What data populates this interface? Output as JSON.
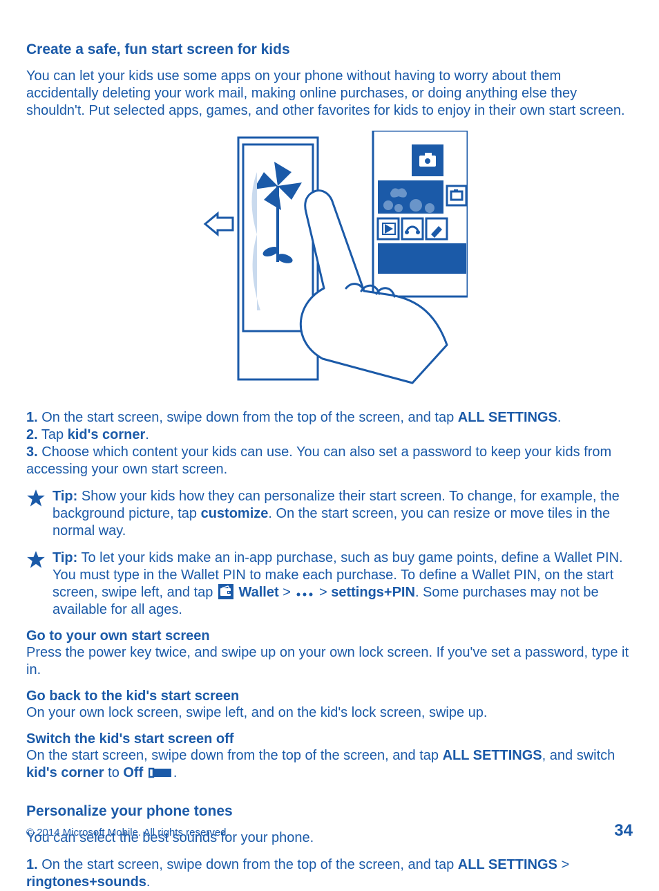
{
  "section1": {
    "title": "Create a safe, fun start screen for kids",
    "intro": "You can let your kids use some apps on your phone without having to worry about them accidentally deleting your work mail, making online purchases, or doing anything else they shouldn't. Put selected apps, games, and other favorites for kids to enjoy in their own start screen.",
    "steps": {
      "s1_num": "1.",
      "s1_a": " On the start screen, swipe down from the top of the screen, and tap ",
      "s1_b": "ALL SETTINGS",
      "s1_c": ".",
      "s2_num": "2.",
      "s2_a": " Tap ",
      "s2_b": "kid's corner",
      "s2_c": ".",
      "s3_num": "3.",
      "s3_a": " Choose which content your kids can use. You can also set a password to keep your kids from accessing your own start screen."
    },
    "tip1": {
      "label": "Tip:",
      "a": " Show your kids how they can personalize their start screen. To change, for example, the background picture, tap ",
      "b": "customize",
      "c": ". On the start screen, you can resize or move tiles in the normal way."
    },
    "tip2": {
      "label": "Tip:",
      "a": " To let your kids make an in-app purchase, such as buy game points, define a Wallet PIN. You must type in the Wallet PIN to make each purchase. To define a Wallet PIN, on the start screen, swipe left, and tap ",
      "wallet": "Wallet",
      "gt1": " > ",
      "gt2": " > ",
      "settings": "settings+PIN",
      "d": ". Some purchases may not be available for all ages."
    },
    "own": {
      "h": "Go to your own start screen",
      "b": "Press the power key twice, and swipe up on your own lock screen. If you've set a password, type it in."
    },
    "back": {
      "h": "Go back to the kid's start screen",
      "b": "On your own lock screen, swipe left, and on the kid's lock screen, swipe up."
    },
    "off": {
      "h": "Switch the kid's start screen off",
      "a": "On the start screen, swipe down from the top of the screen, and tap ",
      "allset": "ALL SETTINGS",
      "b": ", and switch ",
      "kids": "kid's corner",
      "c": " to ",
      "offw": "Off",
      "d": "."
    }
  },
  "section2": {
    "title": "Personalize your phone tones",
    "intro": "You can select the best sounds for your phone.",
    "s1_num": "1.",
    "s1_a": " On the start screen, swipe down from the top of the screen, and tap ",
    "s1_b": "ALL SETTINGS",
    "s1_c": " > ",
    "s1_d": "ringtones+sounds",
    "s1_e": "."
  },
  "footer": {
    "copyright": "© 2014 Microsoft Mobile. All rights reserved.",
    "page": "34"
  }
}
